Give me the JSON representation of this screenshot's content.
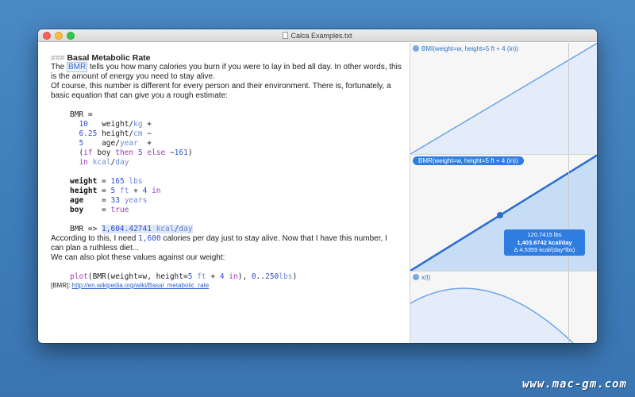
{
  "window": {
    "title": "Calca Examples.txt"
  },
  "editor": {
    "heading_hashes": "###",
    "heading_text": "Basal Metabolic Rate",
    "p1_prefix": "The ",
    "p1_ref": "BMR",
    "p1_suffix": " tells you how many calories you burn if you were to lay in bed all day. In other words, this is the amount of energy you need to stay alive.",
    "p2": "Of course, this number is different for every person and their environment. There is, fortunately, a basic equation that can give you a rough estimate:",
    "p3_prefix": "According to this, I need ",
    "p3_value": "1,600",
    "p3_suffix": " calories per day just to stay alive. Now that I have this number, I can plan a ruthless diet...",
    "p4": "We can also plot these values against our weight:",
    "footnote_label": "[BMR]: ",
    "footnote_link": "http://en.wikipedia.org/wiki/Basal_metabolic_rate"
  },
  "graphs": [
    {
      "label": "BMI(weight=w, height=5 ft + 4 (in))",
      "active": false
    },
    {
      "label": "BMR(weight=w, height=5 ft + 4 (in))",
      "active": true
    },
    {
      "label": "x(t)",
      "active": false
    }
  ],
  "tooltip": {
    "line1": "120.7415 lbs",
    "line2": "1,403.6742 kcal/day",
    "line3": "Δ 4.5359 kcal/(day*lbs)"
  },
  "watermark": "www.mac-gm.com",
  "colors": {
    "accent": "#2f7de1",
    "desktop": "#3e7cba",
    "number": "#2f4cd6",
    "keyword": "#a03bb8",
    "unit": "#6d8ad0"
  }
}
